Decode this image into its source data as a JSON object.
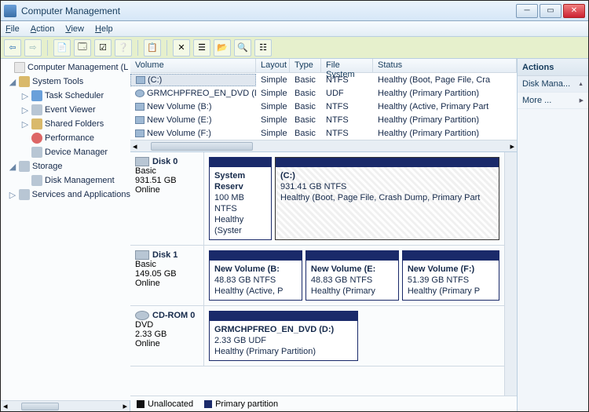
{
  "window": {
    "title": "Computer Management"
  },
  "menu": {
    "file": "File",
    "action": "Action",
    "view": "View",
    "help": "Help"
  },
  "tree": {
    "root": "Computer Management (L",
    "systemTools": "System Tools",
    "taskScheduler": "Task Scheduler",
    "eventViewer": "Event Viewer",
    "sharedFolders": "Shared Folders",
    "performance": "Performance",
    "deviceManager": "Device Manager",
    "storage": "Storage",
    "diskManagement": "Disk Management",
    "services": "Services and Applications"
  },
  "volHeaders": {
    "volume": "Volume",
    "layout": "Layout",
    "type": "Type",
    "fs": "File System",
    "status": "Status"
  },
  "volumes": [
    {
      "name": "(C:)",
      "layout": "Simple",
      "type": "Basic",
      "fs": "NTFS",
      "status": "Healthy (Boot, Page File, Cra"
    },
    {
      "name": "GRMCHPFREO_EN_DVD (D:)",
      "layout": "Simple",
      "type": "Basic",
      "fs": "UDF",
      "status": "Healthy (Primary Partition)"
    },
    {
      "name": "New Volume (B:)",
      "layout": "Simple",
      "type": "Basic",
      "fs": "NTFS",
      "status": "Healthy (Active, Primary Part"
    },
    {
      "name": "New Volume (E:)",
      "layout": "Simple",
      "type": "Basic",
      "fs": "NTFS",
      "status": "Healthy (Primary Partition)"
    },
    {
      "name": "New Volume (F:)",
      "layout": "Simple",
      "type": "Basic",
      "fs": "NTFS",
      "status": "Healthy (Primary Partition)"
    }
  ],
  "disks": {
    "d0": {
      "title": "Disk 0",
      "kind": "Basic",
      "size": "931.51 GB",
      "state": "Online",
      "p0": {
        "name": "System Reserv",
        "line2": "100 MB NTFS",
        "line3": "Healthy (Syster"
      },
      "p1": {
        "name": "(C:)",
        "line2": "931.41 GB NTFS",
        "line3": "Healthy (Boot, Page File, Crash Dump, Primary Part"
      }
    },
    "d1": {
      "title": "Disk 1",
      "kind": "Basic",
      "size": "149.05 GB",
      "state": "Online",
      "p0": {
        "name": "New Volume  (B:",
        "line2": "48.83 GB NTFS",
        "line3": "Healthy (Active, P"
      },
      "p1": {
        "name": "New Volume  (E:",
        "line2": "48.83 GB NTFS",
        "line3": "Healthy (Primary"
      },
      "p2": {
        "name": "New Volume  (F:)",
        "line2": "51.39 GB NTFS",
        "line3": "Healthy (Primary P"
      }
    },
    "cd": {
      "title": "CD-ROM 0",
      "kind": "DVD",
      "size": "2.33 GB",
      "state": "Online",
      "p0": {
        "name": "GRMCHPFREO_EN_DVD  (D:)",
        "line2": "2.33 GB UDF",
        "line3": "Healthy (Primary Partition)"
      }
    }
  },
  "legend": {
    "unalloc": "Unallocated",
    "primary": "Primary partition"
  },
  "actions": {
    "header": "Actions",
    "disk": "Disk Mana...",
    "more": "More ..."
  }
}
